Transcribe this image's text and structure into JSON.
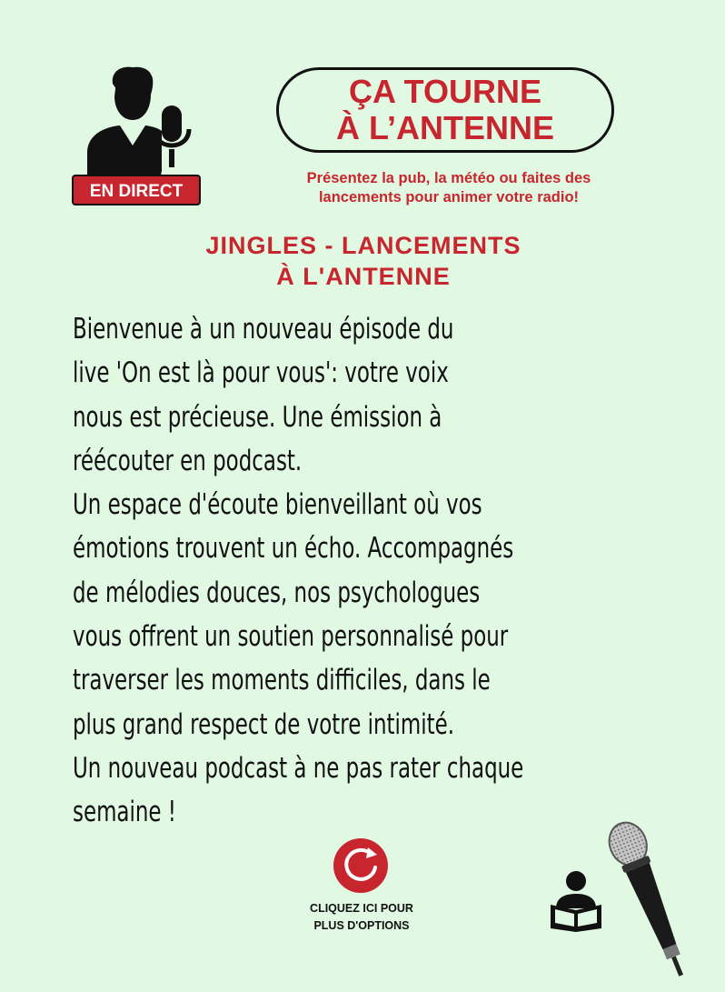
{
  "header": {
    "live_badge": "EN DIRECT",
    "title_line1": "ÇA TOURNE",
    "title_line2": "À L’ANTENNE",
    "tagline_line1": "Présentez la pub, la météo ou faites des",
    "tagline_line2": "lancements pour animer votre radio!"
  },
  "section": {
    "heading_line1": "JINGLES - LANCEMENTS",
    "heading_line2": "À L'ANTENNE"
  },
  "body_lines": [
    "Bienvenue à un nouveau épisode du",
    "live  'On est là pour vous': votre voix",
    "nous est précieuse. Une émission à",
    "réécouter en podcast.",
    "Un espace d'écoute bienveillant où vos",
    "émotions trouvent un écho. Accompagnés",
    "de mélodies douces, nos psychologues",
    "vous offrent un soutien personnalisé pour",
    "traverser les moments  difficiles, dans le",
    "plus grand respect de votre intimité.",
    "Un nouveau podcast à ne pas rater chaque",
    "semaine !"
  ],
  "footer": {
    "options_line1": "CLIQUEZ ICI POUR",
    "options_line2": "PLUS D'OPTIONS"
  },
  "icons": {
    "host": "radio-host-icon",
    "refresh": "refresh-icon",
    "reader": "reader-icon",
    "microphone": "microphone-icon"
  },
  "colors": {
    "background": "#e1f8e3",
    "accent_red": "#c8262e",
    "text": "#111111"
  }
}
